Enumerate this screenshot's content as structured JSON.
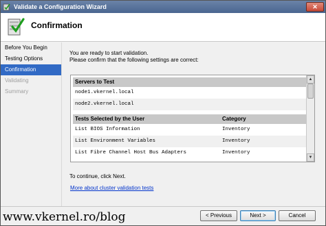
{
  "window": {
    "title": "Validate a Configuration Wizard",
    "close_glyph": "✕"
  },
  "header": {
    "title": "Confirmation"
  },
  "sidebar": {
    "items": [
      {
        "label": "Before You Begin",
        "state": "normal"
      },
      {
        "label": "Testing Options",
        "state": "normal"
      },
      {
        "label": "Confirmation",
        "state": "active"
      },
      {
        "label": "Validating",
        "state": "disabled"
      },
      {
        "label": "Summary",
        "state": "disabled"
      }
    ]
  },
  "main": {
    "intro_line1": "You are ready to start validation.",
    "intro_line2": "Please confirm that the following settings are correct:",
    "servers_header": "Servers to Test",
    "servers": [
      "node1.vkernel.local",
      "node2.vkernel.local"
    ],
    "tests_header": "Tests Selected by the User",
    "category_header": "Category",
    "tests": [
      {
        "name": "List BIOS Information",
        "category": "Inventory"
      },
      {
        "name": "List Environment Variables",
        "category": "Inventory"
      },
      {
        "name": "List Fibre Channel Host Bus Adapters",
        "category": "Inventory"
      }
    ],
    "continue_text": "To continue, click Next.",
    "more_link": "More about cluster validation tests"
  },
  "footer": {
    "watermark": "www.vkernel.ro/blog",
    "previous_label": "< Previous",
    "next_label": "Next >",
    "cancel_label": "Cancel"
  },
  "colors": {
    "selection": "#316ac5",
    "link": "#0033cc",
    "titlebar": "#4a6690"
  }
}
